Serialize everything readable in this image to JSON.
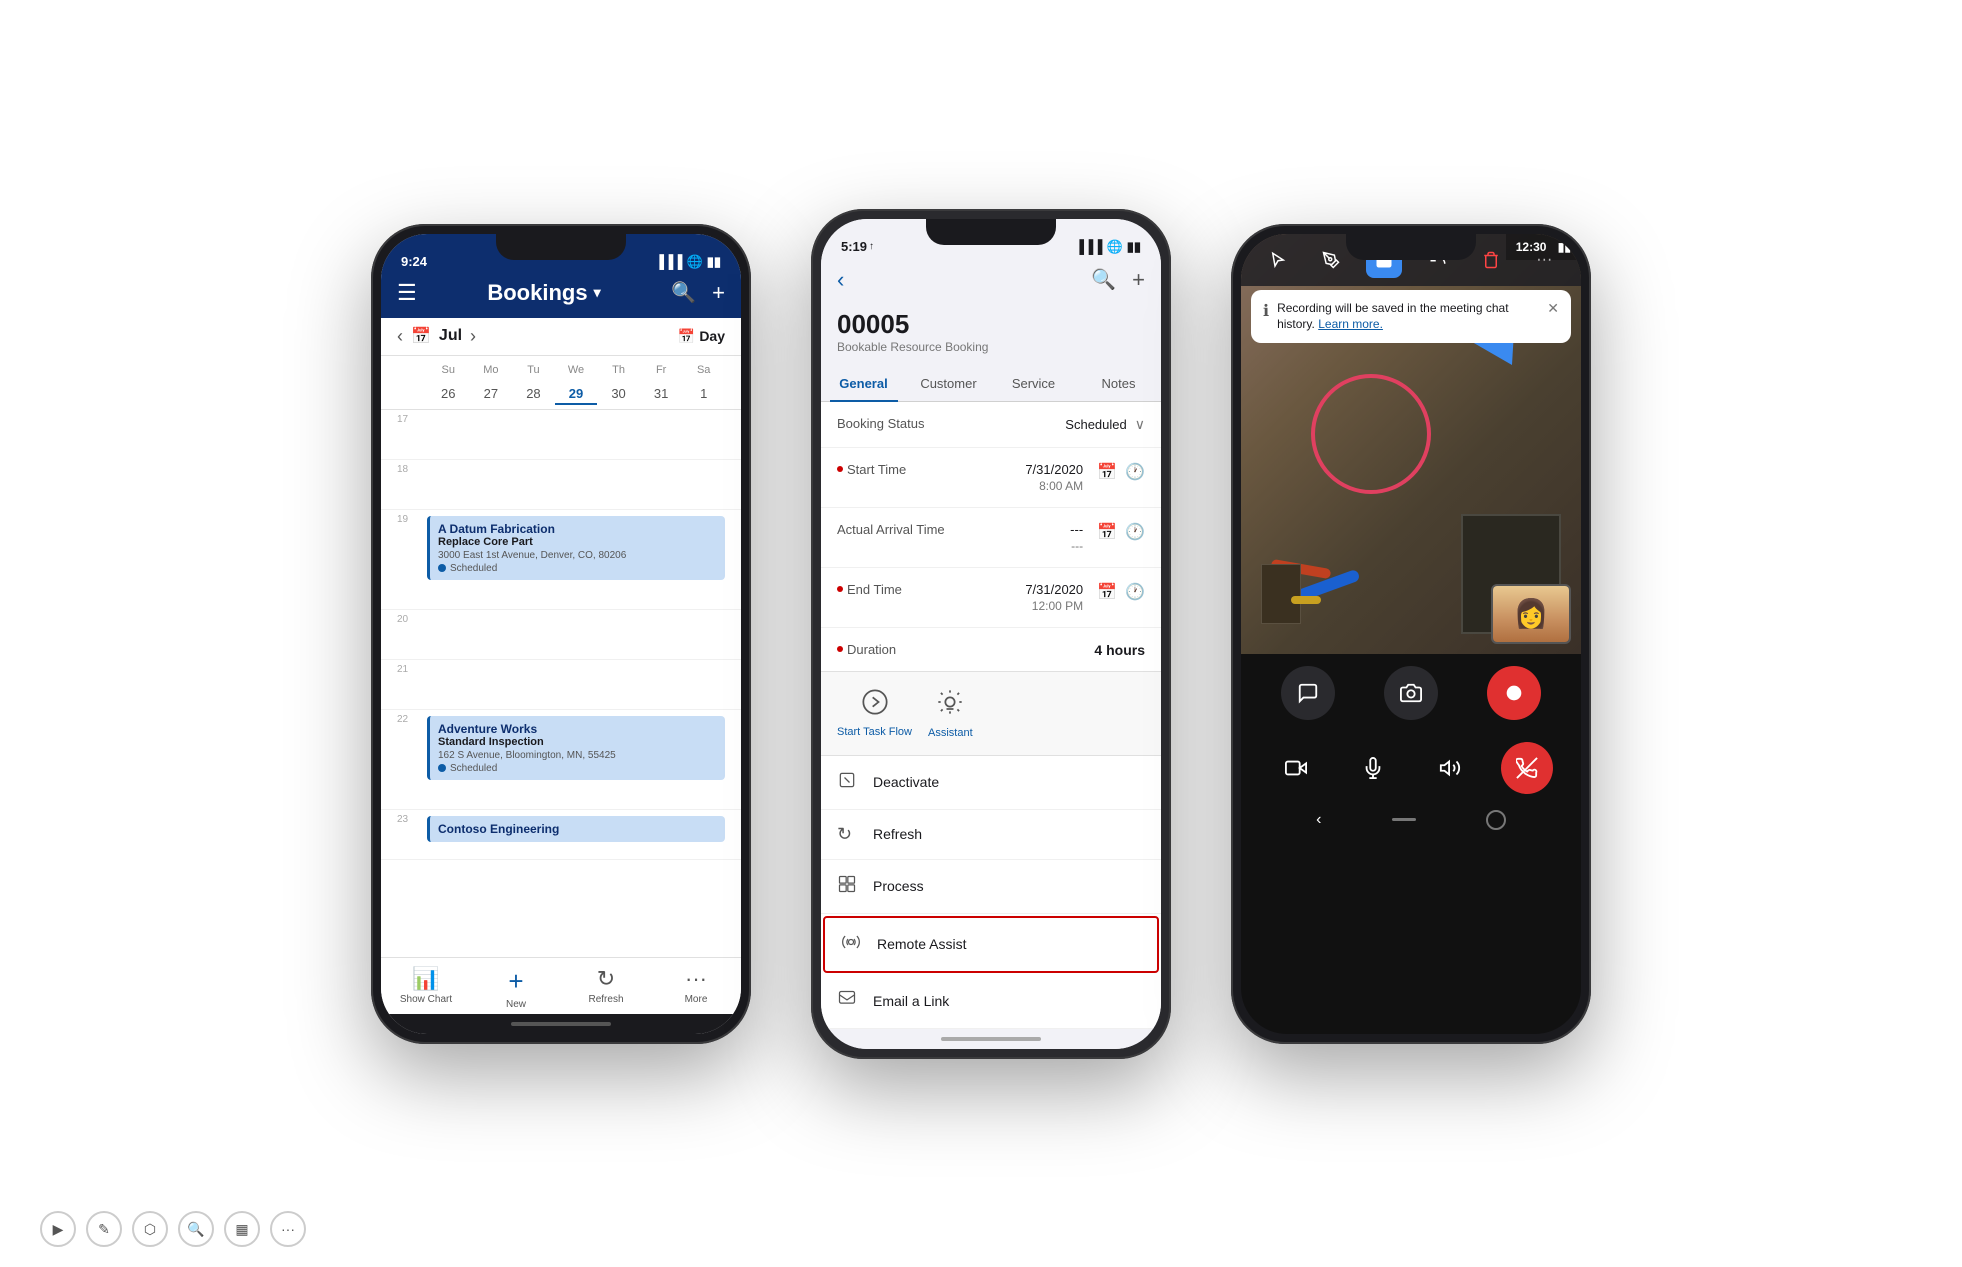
{
  "page": {
    "bg": "#ffffff"
  },
  "phone1": {
    "status": {
      "time": "9:24",
      "signal": "▌▌▌",
      "wifi": "WiFi",
      "battery": "🔋"
    },
    "header": {
      "title": "Bookings",
      "menu_icon": "☰",
      "search_icon": "🔍",
      "add_icon": "+"
    },
    "calendar": {
      "month": "Jul",
      "view": "Day",
      "weekdays": [
        "Su",
        "Mo",
        "Tu",
        "We",
        "Th",
        "Fr",
        "Sa"
      ],
      "dates": [
        "26",
        "27",
        "28",
        "29",
        "30",
        "31",
        "1"
      ],
      "today_index": 3
    },
    "time_rows": [
      {
        "label": "17",
        "cards": []
      },
      {
        "label": "18",
        "cards": []
      },
      {
        "label": "19",
        "cards": [
          {
            "company": "A Datum Fabrication",
            "task": "Replace Core Part",
            "address": "3000 East 1st Avenue, Denver, CO, 80206",
            "status": "Scheduled"
          }
        ]
      },
      {
        "label": "20",
        "cards": []
      },
      {
        "label": "21",
        "cards": []
      },
      {
        "label": "22",
        "cards": [
          {
            "company": "Adventure Works",
            "task": "Standard Inspection",
            "address": "162 S Avenue, Bloomington, MN, 55425",
            "status": "Scheduled"
          }
        ]
      },
      {
        "label": "23",
        "cards": [
          {
            "company": "Contoso Engineering",
            "task": "",
            "address": "",
            "status": ""
          }
        ]
      }
    ],
    "bottom_nav": [
      {
        "label": "Show Chart",
        "icon": "📊"
      },
      {
        "label": "New",
        "icon": "+"
      },
      {
        "label": "Refresh",
        "icon": "↻"
      },
      {
        "label": "More",
        "icon": "•••"
      }
    ]
  },
  "phone2": {
    "status": {
      "time": "5:19",
      "location": "↑",
      "signal": "▌▌▌",
      "wifi": "WiFi",
      "battery": "🔋"
    },
    "header": {
      "back_icon": "‹",
      "search_icon": "🔍",
      "add_icon": "+"
    },
    "record": {
      "number": "00005",
      "subtitle": "Bookable Resource Booking"
    },
    "tabs": [
      {
        "label": "General",
        "active": true
      },
      {
        "label": "Customer",
        "active": false
      },
      {
        "label": "Service",
        "active": false
      },
      {
        "label": "Notes",
        "active": false
      }
    ],
    "fields": [
      {
        "label": "Booking Status",
        "value": "Scheduled",
        "required": false,
        "has_dropdown": true,
        "has_calendar": false,
        "has_clock": false
      },
      {
        "label": "Start Time",
        "value_date": "7/31/2020",
        "value_time": "8:00 AM",
        "required": true,
        "has_calendar": true,
        "has_clock": true
      },
      {
        "label": "Actual Arrival Time",
        "value_date": "---",
        "value_time": "---",
        "required": false,
        "has_calendar": true,
        "has_clock": true
      },
      {
        "label": "End Time",
        "value_date": "7/31/2020",
        "value_time": "12:00 PM",
        "required": true,
        "has_calendar": true,
        "has_clock": true
      },
      {
        "label": "Duration",
        "value": "4 hours",
        "required": true,
        "bold": true
      }
    ],
    "action_buttons": [
      {
        "label": "Start Task Flow",
        "icon": "⚡"
      },
      {
        "label": "Assistant",
        "icon": "💡"
      }
    ],
    "menu_items": [
      {
        "label": "Deactivate",
        "icon": "📄",
        "highlighted": false
      },
      {
        "label": "Refresh",
        "icon": "↻",
        "highlighted": false
      },
      {
        "label": "Process",
        "icon": "🔲",
        "highlighted": false
      },
      {
        "label": "Remote Assist",
        "icon": "⚙",
        "highlighted": true
      },
      {
        "label": "Email a Link",
        "icon": "🔗",
        "highlighted": false
      }
    ]
  },
  "phone3": {
    "status": {
      "time": "12:30",
      "signal": "▌▌▌",
      "wifi": "WiFi",
      "battery": "🔋"
    },
    "recording_notification": {
      "text": "Recording will be saved in the meeting chat history.",
      "link_text": "Learn more."
    },
    "action_icons": [
      {
        "label": "chat",
        "icon": "💬"
      },
      {
        "label": "camera-flip",
        "icon": "📷"
      },
      {
        "label": "record",
        "icon": "⏺"
      }
    ],
    "call_controls": [
      {
        "label": "video",
        "icon": "🎥"
      },
      {
        "label": "mute",
        "icon": "🎤"
      },
      {
        "label": "speaker",
        "icon": "🔊"
      },
      {
        "label": "end-call",
        "icon": "📞"
      }
    ]
  },
  "bottom_icons": [
    {
      "icon": "▶",
      "name": "play"
    },
    {
      "icon": "✎",
      "name": "edit"
    },
    {
      "icon": "⬡",
      "name": "shape"
    },
    {
      "icon": "🔍",
      "name": "search"
    },
    {
      "icon": "▦",
      "name": "grid"
    },
    {
      "icon": "●●●",
      "name": "more"
    }
  ]
}
